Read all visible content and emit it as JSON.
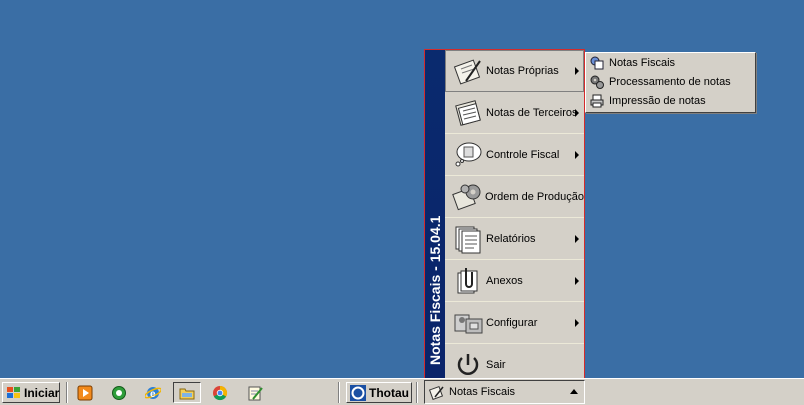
{
  "menu": {
    "side_title": "Notas Fiscais - 15.04.1",
    "items": [
      {
        "label": "Notas Próprias",
        "has_submenu": true,
        "icon": "notes-pen-icon"
      },
      {
        "label": "Notas de Terceiros",
        "has_submenu": true,
        "icon": "document-stack-icon"
      },
      {
        "label": "Controle Fiscal",
        "has_submenu": true,
        "icon": "thought-bubble-icon"
      },
      {
        "label": "Ordem de Produção",
        "has_submenu": false,
        "icon": "production-gears-icon"
      },
      {
        "label": "Relatórios",
        "has_submenu": true,
        "icon": "reports-icon"
      },
      {
        "label": "Anexos",
        "has_submenu": true,
        "icon": "attachment-clip-icon"
      },
      {
        "label": "Configurar",
        "has_submenu": true,
        "icon": "configure-icon"
      },
      {
        "label": "Sair",
        "has_submenu": false,
        "icon": "power-icon"
      }
    ]
  },
  "submenu": {
    "items": [
      {
        "label": "Notas Fiscais",
        "icon": "notes-small-icon"
      },
      {
        "label": "Processamento de notas",
        "icon": "gears-small-icon"
      },
      {
        "label": "Impressão de notas",
        "icon": "printer-icon"
      }
    ]
  },
  "taskbar": {
    "start_label": "Iniciar",
    "thotau_label": "Thotau",
    "app_label": "Notas Fiscais"
  },
  "colors": {
    "desktop": "#3a6ea5",
    "menu_band": "#0a246a",
    "menu_border": "#d42b2b",
    "face": "#d4d0c8"
  }
}
